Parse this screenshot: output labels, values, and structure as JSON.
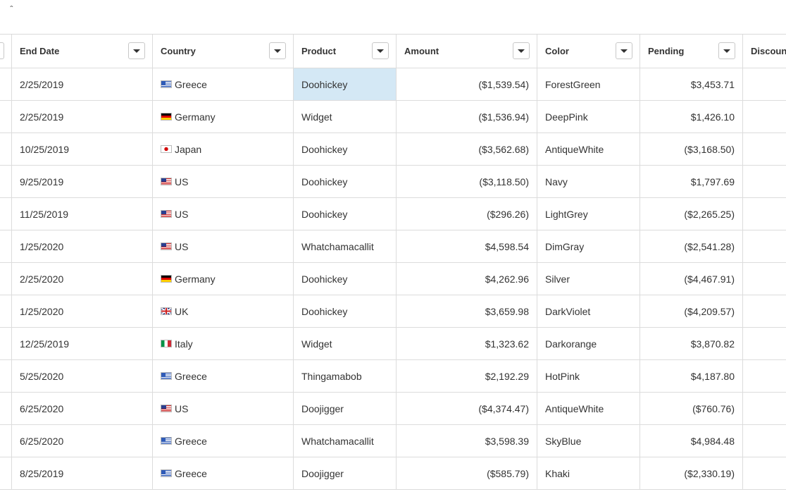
{
  "columns": {
    "end_date": "End Date",
    "country": "Country",
    "product": "Product",
    "amount": "Amount",
    "color": "Color",
    "pending": "Pending",
    "discount": "Discount"
  },
  "rows": [
    {
      "end_date": "2/25/2019",
      "country": "Greece",
      "flag": "greece-flag-icon",
      "product": "Doohickey",
      "amount": "($1,539.54)",
      "color": "ForestGreen",
      "pending": "$3,453.71"
    },
    {
      "end_date": "2/25/2019",
      "country": "Germany",
      "flag": "germany-flag-icon",
      "product": "Widget",
      "amount": "($1,536.94)",
      "color": "DeepPink",
      "pending": "$1,426.10"
    },
    {
      "end_date": "10/25/2019",
      "country": "Japan",
      "flag": "japan-flag-icon",
      "product": "Doohickey",
      "amount": "($3,562.68)",
      "color": "AntiqueWhite",
      "pending": "($3,168.50)"
    },
    {
      "end_date": "9/25/2019",
      "country": "US",
      "flag": "us-flag-icon",
      "product": "Doohickey",
      "amount": "($3,118.50)",
      "color": "Navy",
      "pending": "$1,797.69"
    },
    {
      "end_date": "11/25/2019",
      "country": "US",
      "flag": "us-flag-icon",
      "product": "Doohickey",
      "amount": "($296.26)",
      "color": "LightGrey",
      "pending": "($2,265.25)"
    },
    {
      "end_date": "1/25/2020",
      "country": "US",
      "flag": "us-flag-icon",
      "product": "Whatchamacallit",
      "amount": "$4,598.54",
      "color": "DimGray",
      "pending": "($2,541.28)"
    },
    {
      "end_date": "2/25/2020",
      "country": "Germany",
      "flag": "germany-flag-icon",
      "product": "Doohickey",
      "amount": "$4,262.96",
      "color": "Silver",
      "pending": "($4,467.91)"
    },
    {
      "end_date": "1/25/2020",
      "country": "UK",
      "flag": "uk-flag-icon",
      "product": "Doohickey",
      "amount": "$3,659.98",
      "color": "DarkViolet",
      "pending": "($4,209.57)"
    },
    {
      "end_date": "12/25/2019",
      "country": "Italy",
      "flag": "italy-flag-icon",
      "product": "Widget",
      "amount": "$1,323.62",
      "color": "Darkorange",
      "pending": "$3,870.82"
    },
    {
      "end_date": "5/25/2020",
      "country": "Greece",
      "flag": "greece-flag-icon",
      "product": "Thingamabob",
      "amount": "$2,192.29",
      "color": "HotPink",
      "pending": "$4,187.80"
    },
    {
      "end_date": "6/25/2020",
      "country": "US",
      "flag": "us-flag-icon",
      "product": "Doojigger",
      "amount": "($4,374.47)",
      "color": "AntiqueWhite",
      "pending": "($760.76)"
    },
    {
      "end_date": "6/25/2020",
      "country": "Greece",
      "flag": "greece-flag-icon",
      "product": "Whatchamacallit",
      "amount": "$3,598.39",
      "color": "SkyBlue",
      "pending": "$4,984.48"
    },
    {
      "end_date": "8/25/2019",
      "country": "Greece",
      "flag": "greece-flag-icon",
      "product": "Doojigger",
      "amount": "($585.79)",
      "color": "Khaki",
      "pending": "($2,330.19)"
    }
  ],
  "selected_cell": {
    "row": 0,
    "column": "product"
  },
  "colors": {
    "selection": "#d4e8f5",
    "grid_line": "#dcdcdc"
  }
}
